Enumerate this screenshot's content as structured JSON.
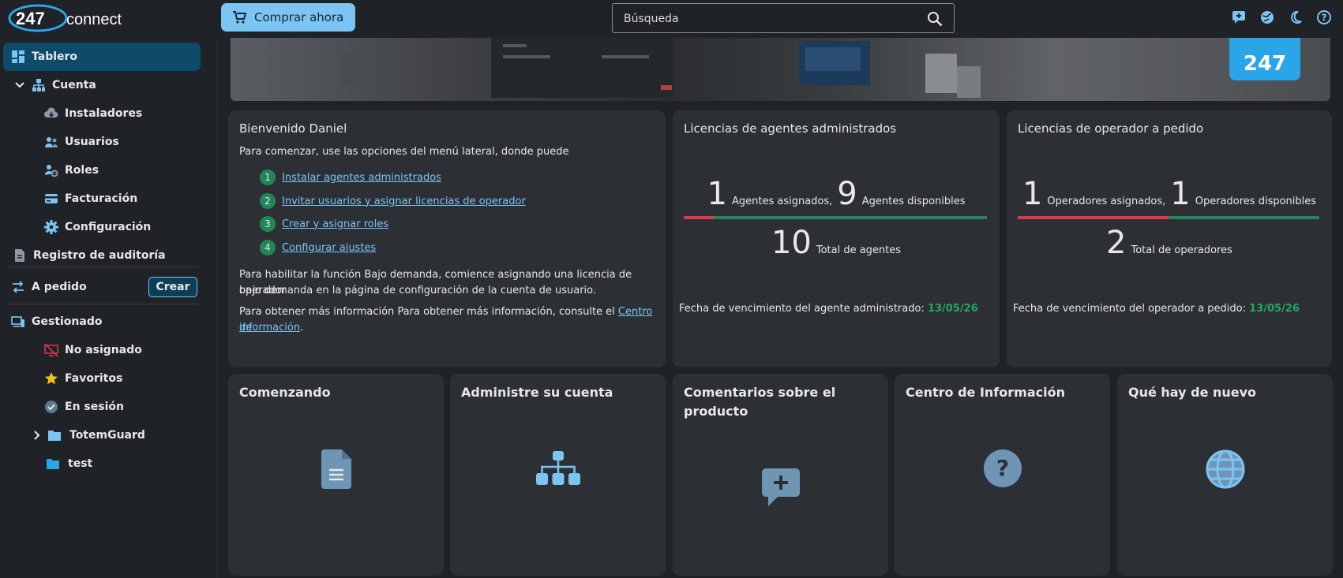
{
  "header": {
    "logo_text": "247 connect",
    "buy_label": "Comprar ahora",
    "search_placeholder": "Búsqueda"
  },
  "sidebar": {
    "items": [
      {
        "label": "Tablero",
        "icon": "dashboard-icon"
      },
      {
        "label": "Cuenta",
        "icon": "org-icon"
      },
      {
        "label": "Instaladores",
        "icon": "cloud-download-icon"
      },
      {
        "label": "Usuarios",
        "icon": "users-icon"
      },
      {
        "label": "Roles",
        "icon": "roles-icon"
      },
      {
        "label": "Facturación",
        "icon": "credit-card-icon"
      },
      {
        "label": "Configuración",
        "icon": "gear-icon"
      },
      {
        "label": "Registro de auditoría",
        "icon": "document-icon"
      },
      {
        "label": "A pedido",
        "icon": "swap-icon"
      },
      {
        "label": "Gestionado",
        "icon": "devices-icon"
      },
      {
        "label": "No asignado",
        "icon": "unassigned-icon"
      },
      {
        "label": "Favoritos",
        "icon": "star-icon"
      },
      {
        "label": "En sesión",
        "icon": "check-circle-icon"
      },
      {
        "label": "TotemGuard",
        "icon": "folder-icon"
      },
      {
        "label": "test",
        "icon": "folder-icon"
      }
    ],
    "crear_label": "Crear"
  },
  "banner": {
    "badge": "247"
  },
  "welcome": {
    "title": "Bienvenido Daniel",
    "intro": "Para comenzar, use las opciones del menú lateral, donde puede",
    "steps": [
      {
        "num": "1",
        "label": "Instalar agentes administrados"
      },
      {
        "num": "2",
        "label": "Invitar usuarios y asignar licencias de operador"
      },
      {
        "num": "3",
        "label": "Crear y asignar roles"
      },
      {
        "num": "4",
        "label": "Configurar ajustes"
      }
    ],
    "para1_line1": "Para habilitar la función Bajo demanda, comience asignando una licencia de operador",
    "para1_line2": "bajo demanda en la página de configuración de la cuenta de usuario.",
    "para2_prefix": "Para obtener más información Para obtener más información, consulte el ",
    "para2_link1": "Centro de",
    "para2_link2": "información",
    "para2_suffix": "."
  },
  "agents": {
    "title": "Licencias de agentes administrados",
    "assigned": "1",
    "assigned_label": "Agentes asignados,",
    "available": "9",
    "available_label": "Agentes disponibles",
    "total": "10",
    "total_label": "Total de agentes",
    "assigned_fraction": 0.1,
    "expiry_label": "Fecha de vencimiento del agente administrado:",
    "expiry_date": "13/05/26"
  },
  "operators": {
    "title": "Licencias de operador a pedido",
    "assigned": "1",
    "assigned_label": "Operadores asignados,",
    "available": "1",
    "available_label": "Operadores disponibles",
    "total": "2",
    "total_label": "Total de operadores",
    "assigned_fraction": 0.5,
    "expiry_label": "Fecha de vencimiento del operador a pedido:",
    "expiry_date": "13/05/26"
  },
  "tiles": [
    {
      "title": "Comenzando",
      "icon": "document-icon"
    },
    {
      "title": "Administre su cuenta",
      "icon": "hierarchy-icon"
    },
    {
      "title_line1": "Comentarios sobre el",
      "title_line2": "producto",
      "icon": "feedback-icon"
    },
    {
      "title": "Centro de Información",
      "icon": "help-icon"
    },
    {
      "title": "Qué hay de nuevo",
      "icon": "globe-icon"
    }
  ],
  "colors": {
    "accent": "#7cc4f4",
    "active_nav": "#0e4a6a",
    "green": "#23a862",
    "red": "#d9394a",
    "card": "#2c3035"
  }
}
